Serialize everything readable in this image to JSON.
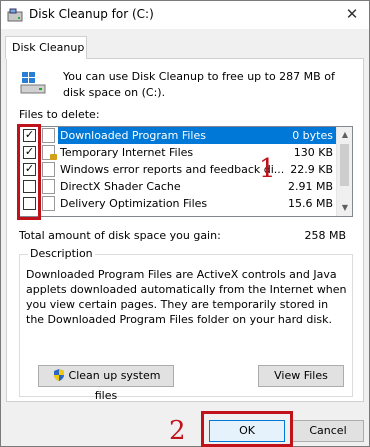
{
  "window": {
    "title": "Disk Cleanup for  (C:)",
    "close_glyph": "✕"
  },
  "tab": {
    "label": "Disk Cleanup"
  },
  "intro": {
    "text": "You can use Disk Cleanup to free up to 287 MB of disk space on  (C:)."
  },
  "files": {
    "label": "Files to delete:",
    "items": [
      {
        "name": "Downloaded Program Files",
        "size": "0 bytes",
        "checked": true,
        "selected": true,
        "icon": "file-icon"
      },
      {
        "name": "Temporary Internet Files",
        "size": "130 KB",
        "checked": true,
        "selected": false,
        "icon": "locked-file-icon"
      },
      {
        "name": "Windows error reports and feedback di...",
        "size": "22.9 KB",
        "checked": true,
        "selected": false,
        "icon": "file-icon"
      },
      {
        "name": "DirectX Shader Cache",
        "size": "2.91 MB",
        "checked": false,
        "selected": false,
        "icon": "file-icon"
      },
      {
        "name": "Delivery Optimization Files",
        "size": "15.6 MB",
        "checked": false,
        "selected": false,
        "icon": "file-icon"
      }
    ]
  },
  "total": {
    "label": "Total amount of disk space you gain:",
    "value": "258 MB"
  },
  "description": {
    "legend": "Description",
    "text": "Downloaded Program Files are ActiveX controls and Java applets downloaded automatically from the Internet when you view certain pages. They are temporarily stored in the Downloaded Program Files folder on your hard disk."
  },
  "buttons": {
    "cleanup_system": "Clean up system files",
    "view_files": "View Files",
    "ok": "OK",
    "cancel": "Cancel"
  },
  "annotations": {
    "one": "1",
    "two": "2"
  },
  "colors": {
    "annotation_red": "#c0121a",
    "selection_blue": "#0078d7"
  }
}
